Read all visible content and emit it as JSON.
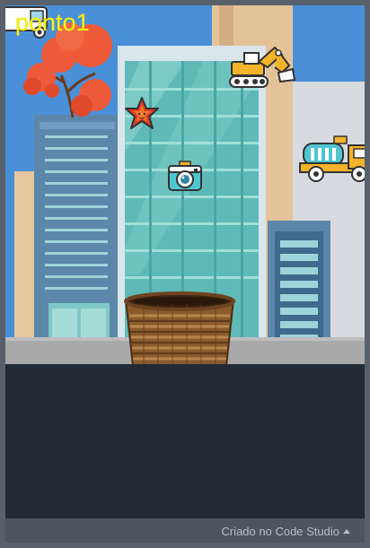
{
  "game": {
    "score_label": "ponto1"
  },
  "footer": {
    "credit_label": "Criado no Code Studio"
  },
  "sprites": {
    "falling_items": [
      "excavator",
      "star",
      "camera",
      "cement-truck"
    ],
    "player": "basket",
    "partial_sprite": "truck"
  },
  "colors": {
    "sky": "#4a90d9",
    "score_text": "#f5f01a",
    "panel": "#212b35",
    "footer_bar": "#4c5660",
    "frame": "#56616c"
  }
}
